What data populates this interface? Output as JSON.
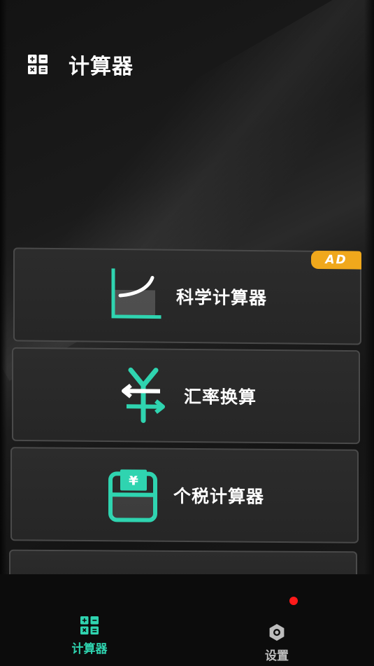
{
  "header": {
    "title": "计算器",
    "icon": "calculator-grid-icon"
  },
  "cards": [
    {
      "label": "科学计算器",
      "icon": "curve-chart-icon",
      "badge": "AD"
    },
    {
      "label": "汇率换算",
      "icon": "yen-exchange-icon"
    },
    {
      "label": "个税计算器",
      "icon": "yen-wallet-icon"
    }
  ],
  "bottom_nav": {
    "calculator": {
      "label": "计算器",
      "icon": "calculator-grid-icon",
      "active": true
    },
    "settings": {
      "label": "设置",
      "icon": "gear-icon",
      "notification_dot": true
    }
  },
  "colors": {
    "accent": "#2fd4b0",
    "ad_badge": "#f0a81c",
    "notification": "#ff1a1a",
    "text": "#ffffff"
  }
}
